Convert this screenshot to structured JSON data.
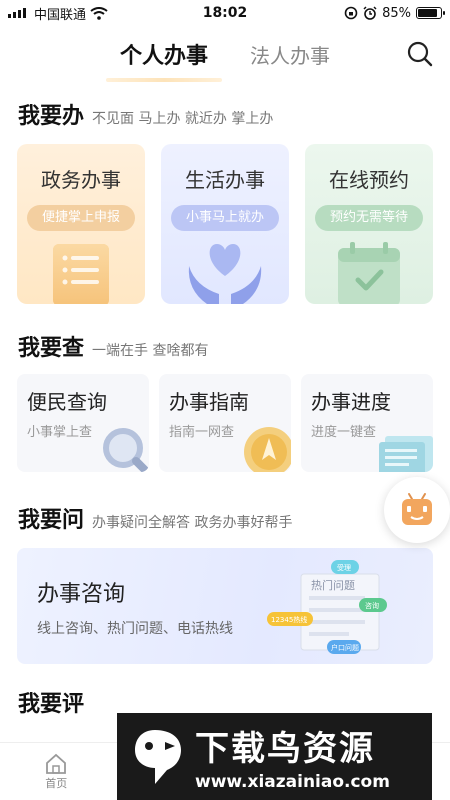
{
  "status": {
    "carrier": "中国联通",
    "time": "18:02",
    "battery": "85%",
    "battery_level": 0.85
  },
  "header": {
    "tabs": [
      "个人办事",
      "法人办事"
    ],
    "active_tab": 0
  },
  "section1": {
    "title": "我要办",
    "subtitle": "不见面 马上办 就近办 掌上办",
    "cards": [
      {
        "title": "政务办事",
        "pill": "便捷掌上申报",
        "icon": "document-icon"
      },
      {
        "title": "生活办事",
        "pill": "小事马上就办",
        "icon": "heart-hands-icon"
      },
      {
        "title": "在线预约",
        "pill": "预约无需等待",
        "icon": "calendar-check-icon"
      }
    ]
  },
  "section2": {
    "title": "我要查",
    "subtitle": "一端在手 查啥都有",
    "cards": [
      {
        "title": "便民查询",
        "sub": "小事掌上查",
        "icon": "magnifier-icon"
      },
      {
        "title": "办事指南",
        "sub": "指南一网查",
        "icon": "compass-icon"
      },
      {
        "title": "办事进度",
        "sub": "进度一键查",
        "icon": "progress-doc-icon"
      }
    ]
  },
  "section3": {
    "title": "我要问",
    "subtitle": "办事疑问全解答 政务办事好帮手",
    "consult": {
      "title": "办事咨询",
      "sub": "线上咨询、热门问题、电话热线",
      "art_title": "热门问题",
      "bubbles": [
        "受理",
        "咨询",
        "12345热线",
        "户口问题"
      ]
    }
  },
  "section4": {
    "title": "我要评"
  },
  "bottomnav": {
    "items": [
      "首页"
    ]
  },
  "watermark": {
    "line1": "下载鸟资源",
    "line2": "www.xiazainiao.com"
  }
}
